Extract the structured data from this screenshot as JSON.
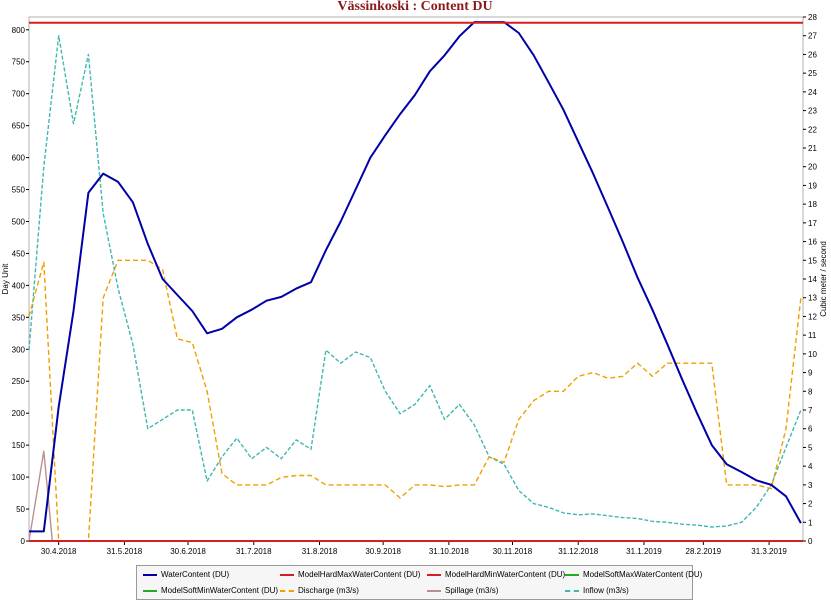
{
  "chart_data": {
    "type": "line",
    "title": "Vässinkoski : Content DU",
    "ylabel": "Day Unit",
    "y2label": "Cubic meter / second",
    "ylim": [
      0,
      820
    ],
    "y2lim": [
      0,
      28
    ],
    "yticks": [
      0,
      50,
      100,
      150,
      200,
      250,
      300,
      350,
      400,
      450,
      500,
      550,
      600,
      650,
      700,
      750,
      800
    ],
    "y2ticks": [
      0,
      1,
      2,
      3,
      4,
      5,
      6,
      7,
      8,
      9,
      10,
      11,
      12,
      13,
      14,
      15,
      16,
      17,
      18,
      19,
      20,
      21,
      22,
      23,
      24,
      25,
      26,
      27,
      28
    ],
    "xlim": [
      "2018-04-16",
      "2019-04-16"
    ],
    "xticks": [
      {
        "date": "2018-04-30",
        "label": "30.4.2018"
      },
      {
        "date": "2018-05-31",
        "label": "31.5.2018"
      },
      {
        "date": "2018-06-30",
        "label": "30.6.2018"
      },
      {
        "date": "2018-07-31",
        "label": "31.7.2018"
      },
      {
        "date": "2018-08-31",
        "label": "31.8.2018"
      },
      {
        "date": "2018-09-30",
        "label": "30.9.2018"
      },
      {
        "date": "2018-10-31",
        "label": "31.10.2018"
      },
      {
        "date": "2018-11-30",
        "label": "30.11.2018"
      },
      {
        "date": "2018-12-31",
        "label": "31.12.2018"
      },
      {
        "date": "2019-01-31",
        "label": "31.1.2019"
      },
      {
        "date": "2019-02-28",
        "label": "28.2.2019"
      },
      {
        "date": "2019-03-31",
        "label": "31.3.2019"
      }
    ],
    "grid": false,
    "legend": "bottom",
    "series": [
      {
        "name": "WaterContent (DU)",
        "axis": "left",
        "color": "#0000a8",
        "style": "solid",
        "x": [
          "2018-04-16",
          "2018-04-23",
          "2018-04-30",
          "2018-05-07",
          "2018-05-14",
          "2018-05-21",
          "2018-05-28",
          "2018-06-04",
          "2018-06-11",
          "2018-06-18",
          "2018-06-25",
          "2018-07-02",
          "2018-07-09",
          "2018-07-16",
          "2018-07-23",
          "2018-07-30",
          "2018-08-06",
          "2018-08-13",
          "2018-08-20",
          "2018-08-27",
          "2018-09-03",
          "2018-09-10",
          "2018-09-17",
          "2018-09-24",
          "2018-10-01",
          "2018-10-08",
          "2018-10-15",
          "2018-10-22",
          "2018-10-29",
          "2018-11-05",
          "2018-11-12",
          "2018-11-19",
          "2018-11-26",
          "2018-12-03",
          "2018-12-10",
          "2018-12-17",
          "2018-12-24",
          "2018-12-31",
          "2019-01-07",
          "2019-01-14",
          "2019-01-21",
          "2019-01-28",
          "2019-02-04",
          "2019-02-11",
          "2019-02-18",
          "2019-02-25",
          "2019-03-04",
          "2019-03-11",
          "2019-03-18",
          "2019-03-25",
          "2019-04-01",
          "2019-04-08",
          "2019-04-15"
        ],
        "values": [
          15,
          15,
          210,
          360,
          545,
          575,
          562,
          530,
          465,
          410,
          385,
          360,
          325,
          332,
          350,
          362,
          376,
          382,
          395,
          405,
          455,
          500,
          550,
          600,
          635,
          668,
          698,
          735,
          760,
          790,
          812,
          812,
          812,
          795,
          760,
          718,
          675,
          625,
          575,
          522,
          468,
          412,
          362,
          308,
          253,
          200,
          150,
          120,
          108,
          95,
          88,
          70,
          28
        ]
      },
      {
        "name": "ModelHardMaxWaterContent (DU)",
        "axis": "left",
        "color": "#d42020",
        "style": "solid",
        "x": [
          "2018-04-16",
          "2019-04-16"
        ],
        "values": [
          811,
          811
        ]
      },
      {
        "name": "ModelHardMinWaterContent (DU)",
        "axis": "left",
        "color": "#d42020",
        "style": "solid",
        "x": [
          "2018-04-16",
          "2019-04-16"
        ],
        "values": [
          0,
          0
        ]
      },
      {
        "name": "ModelSoftMaxWaterContent (DU)",
        "axis": "left",
        "color": "#22aa22",
        "style": "solid",
        "x": [],
        "values": []
      },
      {
        "name": "ModelSoftMinWaterContent (DU)",
        "axis": "left",
        "color": "#22aa22",
        "style": "solid",
        "x": [],
        "values": []
      },
      {
        "name": "Discharge (m3/s)",
        "axis": "right",
        "color": "#f0a000",
        "style": "dashed",
        "x": [
          "2018-04-16",
          "2018-04-23",
          "2018-04-30",
          "2018-05-07",
          "2018-05-14",
          "2018-05-21",
          "2018-05-28",
          "2018-06-04",
          "2018-06-11",
          "2018-06-18",
          "2018-06-25",
          "2018-07-02",
          "2018-07-09",
          "2018-07-16",
          "2018-07-23",
          "2018-07-30",
          "2018-08-06",
          "2018-08-13",
          "2018-08-20",
          "2018-08-27",
          "2018-09-03",
          "2018-09-10",
          "2018-09-17",
          "2018-09-24",
          "2018-10-01",
          "2018-10-08",
          "2018-10-15",
          "2018-10-22",
          "2018-10-29",
          "2018-11-05",
          "2018-11-12",
          "2018-11-19",
          "2018-11-26",
          "2018-12-03",
          "2018-12-10",
          "2018-12-17",
          "2018-12-24",
          "2018-12-31",
          "2019-01-07",
          "2019-01-14",
          "2019-01-21",
          "2019-01-28",
          "2019-02-04",
          "2019-02-11",
          "2019-02-18",
          "2019-02-25",
          "2019-03-04",
          "2019-03-11",
          "2019-03-18",
          "2019-03-25",
          "2019-04-01",
          "2019-04-08",
          "2019-04-15"
        ],
        "values": [
          12,
          14.9,
          0,
          0,
          0,
          13,
          15,
          15,
          15,
          14.5,
          10.8,
          10.6,
          8,
          3.6,
          3,
          3,
          3,
          3.4,
          3.5,
          3.5,
          3,
          3,
          3,
          3,
          3,
          2.3,
          3,
          3,
          2.9,
          3,
          3,
          4.5,
          4.2,
          6.5,
          7.5,
          8,
          8,
          8.8,
          9,
          8.7,
          8.8,
          9.5,
          8.8,
          9.5,
          9.5,
          9.5,
          9.5,
          3,
          3,
          3,
          2.8,
          6,
          13
        ]
      },
      {
        "name": "Spillage (m3/s)",
        "axis": "right",
        "color": "#b89090",
        "style": "solid",
        "x": [
          "2018-04-16",
          "2018-04-23",
          "2018-04-27",
          "2018-04-30",
          "2018-05-07"
        ],
        "values": [
          0,
          4.8,
          0,
          0,
          0
        ]
      },
      {
        "name": "Inflow (m3/s)",
        "axis": "right",
        "color": "#40b8b0",
        "style": "dashed",
        "x": [
          "2018-04-16",
          "2018-04-23",
          "2018-04-30",
          "2018-05-07",
          "2018-05-14",
          "2018-05-21",
          "2018-05-28",
          "2018-06-04",
          "2018-06-11",
          "2018-06-18",
          "2018-06-25",
          "2018-07-02",
          "2018-07-09",
          "2018-07-16",
          "2018-07-23",
          "2018-07-30",
          "2018-08-06",
          "2018-08-13",
          "2018-08-20",
          "2018-08-27",
          "2018-09-03",
          "2018-09-10",
          "2018-09-17",
          "2018-09-24",
          "2018-10-01",
          "2018-10-08",
          "2018-10-15",
          "2018-10-22",
          "2018-10-29",
          "2018-11-05",
          "2018-11-12",
          "2018-11-19",
          "2018-11-26",
          "2018-12-03",
          "2018-12-10",
          "2018-12-17",
          "2018-12-24",
          "2018-12-31",
          "2019-01-07",
          "2019-01-14",
          "2019-01-21",
          "2019-01-28",
          "2019-02-04",
          "2019-02-11",
          "2019-02-18",
          "2019-02-25",
          "2019-03-04",
          "2019-03-11",
          "2019-03-18",
          "2019-03-25",
          "2019-04-01",
          "2019-04-08",
          "2019-04-15"
        ],
        "values": [
          10.2,
          20,
          27,
          22.3,
          26,
          17.5,
          13.5,
          10.5,
          6,
          6.5,
          7,
          7,
          3.2,
          4.5,
          5.5,
          4.4,
          5,
          4.4,
          5.4,
          4.9,
          10.2,
          9.5,
          10.1,
          9.8,
          8,
          6.8,
          7.3,
          8.3,
          6.5,
          7.3,
          6.2,
          4.5,
          4.1,
          2.7,
          2,
          1.8,
          1.5,
          1.4,
          1.45,
          1.35,
          1.25,
          1.2,
          1.05,
          1,
          0.9,
          0.85,
          0.75,
          0.8,
          1,
          1.8,
          3,
          5,
          7
        ]
      }
    ]
  }
}
